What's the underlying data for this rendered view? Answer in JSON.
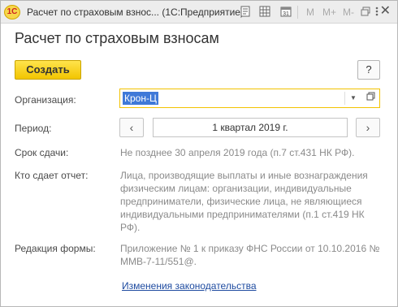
{
  "titlebar": {
    "app_logo": "1С",
    "title": "Расчет по страховым взнос...  (1С:Предприятие)",
    "m_label": "M",
    "mplus_label": "M+",
    "mminus_label": "M-",
    "icons": [
      "document-icon",
      "grid-icon",
      "calendar-icon",
      "restore-icon",
      "more-icon",
      "close-icon"
    ],
    "calendar_day": "31"
  },
  "header": {
    "title": "Расчет по страховым взносам"
  },
  "toolbar": {
    "create_label": "Создать",
    "help_label": "?"
  },
  "form": {
    "organization_label": "Организация:",
    "organization_value": "Крон-Ц",
    "period_label": "Период:",
    "period_value": "1 квартал 2019 г.",
    "deadline_label": "Срок сдачи:",
    "deadline_value": "Не позднее 30 апреля 2019 года (п.7 ст.431 НК РФ).",
    "who_label": "Кто сдает отчет:",
    "who_value": "Лица, производящие выплаты и иные вознаграждения физическим лицам: организации, индивидуальные предприниматели, физические лица, не являющиеся индивидуальными предпринимателями (п.1 ст.419 НК РФ).",
    "edition_label": "Редакция формы:",
    "edition_value": "Приложение № 1 к приказу ФНС России от 10.10.2016 № ММВ-7-11/551@.",
    "law_changes_link": "Изменения законодательства"
  },
  "colors": {
    "accent_yellow": "#f2c500",
    "selection_blue": "#3f79d8",
    "link_blue": "#1e4ba0"
  }
}
